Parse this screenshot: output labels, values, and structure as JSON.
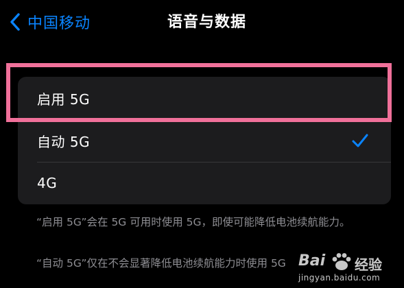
{
  "nav": {
    "back_label": "中国移动",
    "title": "语音与数据"
  },
  "options": [
    {
      "label": "启用 5G",
      "selected": false,
      "highlighted": true
    },
    {
      "label": "自动 5G",
      "selected": true,
      "highlighted": false
    },
    {
      "label": "4G",
      "selected": false,
      "highlighted": false
    }
  ],
  "footnotes": [
    "“启用 5G”会在 5G 可用时使用 5G，即使可能降低电池续航能力。",
    "“自动 5G”仅在不会显著降低电池续航能力时使用 5G"
  ],
  "watermark": {
    "brand_left": "Bai",
    "brand_right": "经验",
    "url": "jingyan.baidu.com"
  },
  "colors": {
    "accent": "#0a84ff",
    "highlight": "#f0709a",
    "group_bg": "#1c1c1e",
    "secondary_text": "#8e8e93"
  },
  "icons": {
    "back": "chevron-left-icon",
    "check": "checkmark-icon",
    "watermark": "baidu-paw-icon"
  }
}
